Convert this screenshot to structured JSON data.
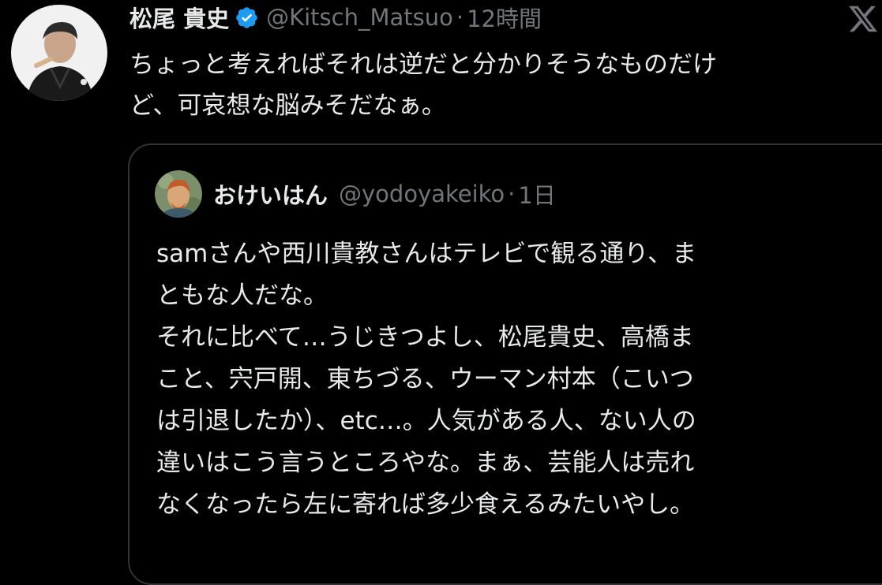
{
  "tweet": {
    "author": {
      "display_name": "松尾 貴史",
      "handle": "@Kitsch_Matsuo",
      "verified": true
    },
    "separator": "·",
    "time": "12時間",
    "text": "ちょっと考えればそれは逆だと分かりそうなものだけ\nど、可哀想な脳みそだなぁ。"
  },
  "quoted_tweet": {
    "author": {
      "display_name": "おけいはん",
      "handle": "@yodoyakeiko"
    },
    "separator": "·",
    "time": "1日",
    "text": "samさんや西川貴教さんはテレビで観る通り、ま\nともな人だな。\nそれに比べて…うじきつよし、松尾貴史、高橋ま\nこと、宍戸開、東ちづる、ウーマン村本（こいつ\nは引退したか）、etc…。人気がある人、ない人の\n違いはこう言うところやな。まぁ、芸能人は売れ\nなくなったら左に寄れば多少食えるみたいやし。"
  },
  "icons": {
    "verified": "verified-badge-icon",
    "platform": "x-logo-icon"
  },
  "colors": {
    "background": "#000000",
    "text_primary": "#e7e9ea",
    "text_secondary": "#71767b",
    "verified_blue": "#1d9bf0",
    "card_border": "#2f3336"
  }
}
